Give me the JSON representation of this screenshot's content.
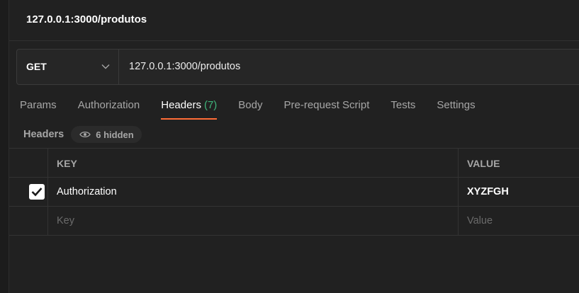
{
  "request": {
    "title": "127.0.0.1:3000/produtos",
    "method": "GET",
    "url": "127.0.0.1:3000/produtos"
  },
  "tabs": [
    {
      "label": "Params"
    },
    {
      "label": "Authorization"
    },
    {
      "label": "Headers",
      "count": "(7)",
      "active": true
    },
    {
      "label": "Body"
    },
    {
      "label": "Pre-request Script"
    },
    {
      "label": "Tests"
    },
    {
      "label": "Settings"
    }
  ],
  "headers_section": {
    "label": "Headers",
    "hidden_text": "6 hidden"
  },
  "table": {
    "columns": {
      "key": "KEY",
      "value": "VALUE"
    },
    "rows": [
      {
        "checked": true,
        "key": "Authorization",
        "value": "XYZFGH"
      }
    ],
    "placeholder": {
      "key": "Key",
      "value": "Value"
    }
  },
  "colors": {
    "accent": "#ff6c37",
    "count": "#3fb47a",
    "background": "#212121"
  },
  "icons": {
    "method_dropdown": "chevron-down-icon",
    "hidden_toggle": "eye-icon",
    "row_check": "checkmark-icon"
  }
}
